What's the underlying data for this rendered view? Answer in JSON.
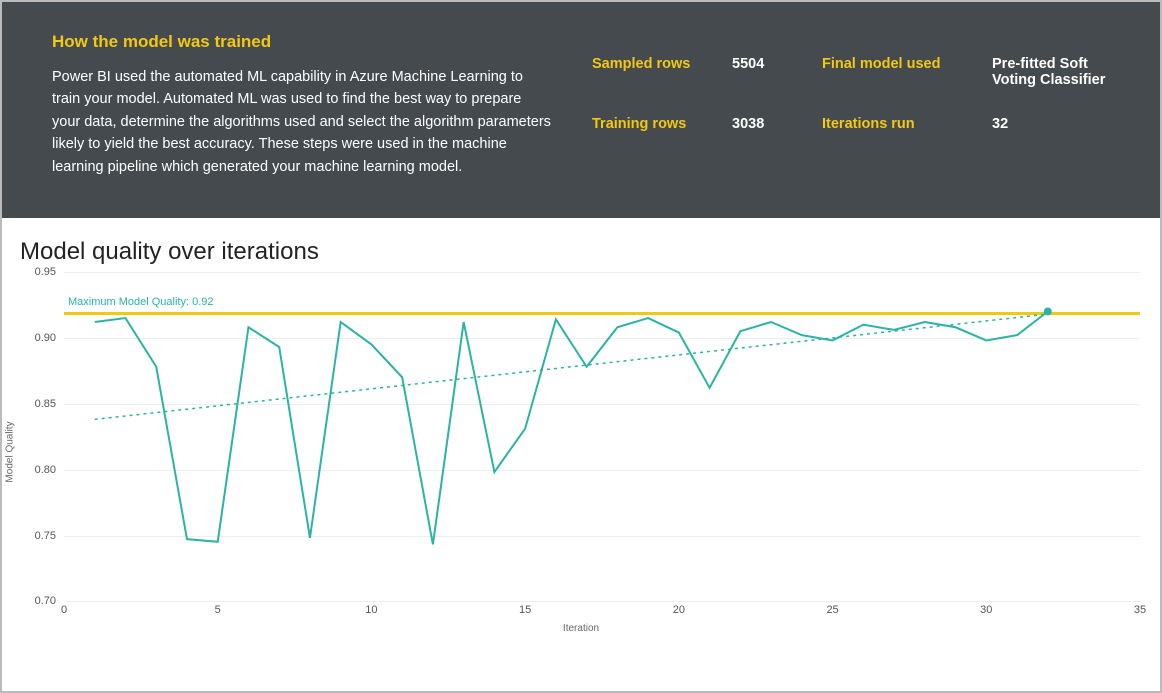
{
  "header": {
    "title": "How the model was trained",
    "description": "Power BI used the automated ML capability in Azure Machine Learning to train your model. Automated ML was used to find the best way to prepare your data, determine the algorithms used and select the algorithm parameters likely to yield the best accuracy. These steps were used in the machine learning pipeline which generated your machine learning model."
  },
  "metrics": {
    "sampled_label": "Sampled rows",
    "sampled_value": "5504",
    "training_label": "Training rows",
    "training_value": "3038",
    "final_model_label": "Final model used",
    "final_model_value": "Pre-fitted Soft Voting Classifier",
    "iterations_label": "Iterations run",
    "iterations_value": "32"
  },
  "chart": {
    "title": "Model quality over iterations",
    "ylabel": "Model Quality",
    "xlabel": "Iteration",
    "max_label": "Maximum Model Quality: 0.92",
    "y_ticks": [
      "0.70",
      "0.75",
      "0.80",
      "0.85",
      "0.90",
      "0.95"
    ],
    "x_ticks": [
      "0",
      "5",
      "10",
      "15",
      "20",
      "25",
      "30",
      "35"
    ]
  },
  "chart_data": {
    "type": "line",
    "title": "Model quality over iterations",
    "xlabel": "Iteration",
    "ylabel": "Model Quality",
    "xlim": [
      0,
      35
    ],
    "ylim": [
      0.7,
      0.95
    ],
    "max_line": 0.92,
    "trend": {
      "x1": 1,
      "y1": 0.838,
      "x2": 32,
      "y2": 0.918
    },
    "x": [
      1,
      2,
      3,
      4,
      5,
      6,
      7,
      8,
      9,
      10,
      11,
      12,
      13,
      14,
      15,
      16,
      17,
      18,
      19,
      20,
      21,
      22,
      23,
      24,
      25,
      26,
      27,
      28,
      29,
      30,
      31,
      32
    ],
    "values": [
      0.912,
      0.915,
      0.878,
      0.747,
      0.745,
      0.908,
      0.893,
      0.748,
      0.912,
      0.895,
      0.87,
      0.743,
      0.912,
      0.798,
      0.831,
      0.914,
      0.878,
      0.908,
      0.915,
      0.904,
      0.862,
      0.905,
      0.912,
      0.902,
      0.898,
      0.91,
      0.906,
      0.912,
      0.908,
      0.898,
      0.902,
      0.92
    ]
  }
}
